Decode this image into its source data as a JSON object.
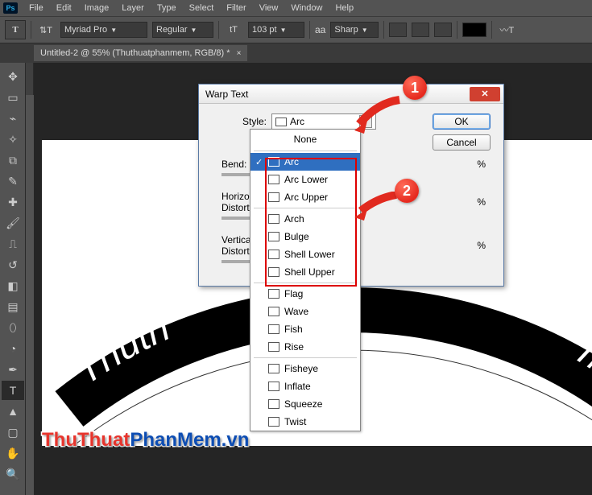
{
  "menubar": {
    "items": [
      "File",
      "Edit",
      "Image",
      "Layer",
      "Type",
      "Select",
      "Filter",
      "View",
      "Window",
      "Help"
    ]
  },
  "optionsbar": {
    "font_family": "Myriad Pro",
    "font_style": "Regular",
    "font_size": "103 pt",
    "aa_label": "aa",
    "aa_mode": "Sharp"
  },
  "tab": {
    "title": "Untitled-2 @ 55% (Thuthuatphanmem, RGB/8) *"
  },
  "canvas_text": {
    "left": "Thuth",
    "right": "m"
  },
  "dialog": {
    "title": "Warp Text",
    "style_label": "Style:",
    "style_value": "Arc",
    "bend_label": "Bend:",
    "hdist_label": "Horizontal Distortion:",
    "vdist_label": "Vertical Distortion:",
    "pct": "%",
    "ok": "OK",
    "cancel": "Cancel"
  },
  "style_options": {
    "none": "None",
    "group1": [
      "Arc",
      "Arc Lower",
      "Arc Upper"
    ],
    "group2": [
      "Arch",
      "Bulge",
      "Shell Lower",
      "Shell Upper"
    ],
    "group3": [
      "Flag",
      "Wave",
      "Fish",
      "Rise"
    ],
    "group4": [
      "Fisheye",
      "Inflate",
      "Squeeze",
      "Twist"
    ]
  },
  "callouts": {
    "one": "1",
    "two": "2"
  },
  "watermark": {
    "part1": "ThuThuat",
    "part2": "PhanMem",
    "ext": ".vn"
  }
}
